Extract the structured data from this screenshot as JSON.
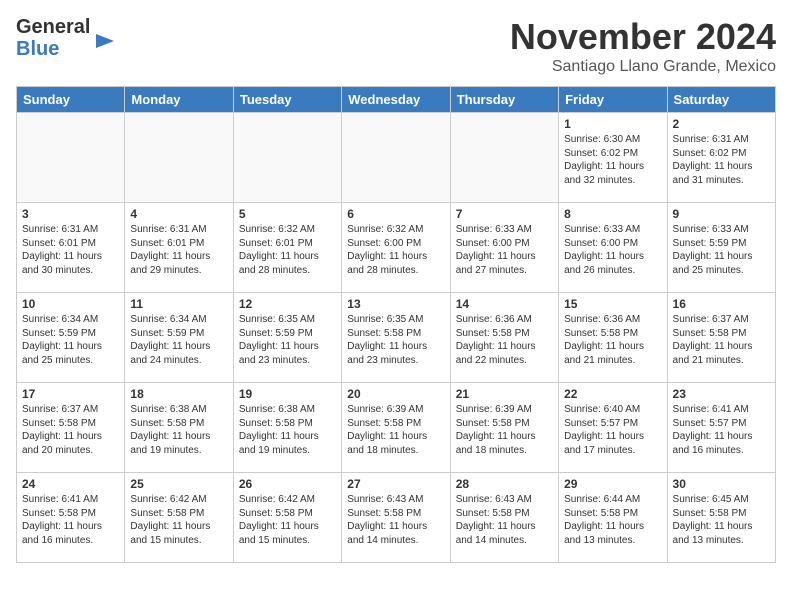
{
  "header": {
    "logo_line1": "General",
    "logo_line2": "Blue",
    "month": "November 2024",
    "location": "Santiago Llano Grande, Mexico"
  },
  "weekdays": [
    "Sunday",
    "Monday",
    "Tuesday",
    "Wednesday",
    "Thursday",
    "Friday",
    "Saturday"
  ],
  "weeks": [
    [
      {
        "day": "",
        "info": ""
      },
      {
        "day": "",
        "info": ""
      },
      {
        "day": "",
        "info": ""
      },
      {
        "day": "",
        "info": ""
      },
      {
        "day": "",
        "info": ""
      },
      {
        "day": "1",
        "info": "Sunrise: 6:30 AM\nSunset: 6:02 PM\nDaylight: 11 hours\nand 32 minutes."
      },
      {
        "day": "2",
        "info": "Sunrise: 6:31 AM\nSunset: 6:02 PM\nDaylight: 11 hours\nand 31 minutes."
      }
    ],
    [
      {
        "day": "3",
        "info": "Sunrise: 6:31 AM\nSunset: 6:01 PM\nDaylight: 11 hours\nand 30 minutes."
      },
      {
        "day": "4",
        "info": "Sunrise: 6:31 AM\nSunset: 6:01 PM\nDaylight: 11 hours\nand 29 minutes."
      },
      {
        "day": "5",
        "info": "Sunrise: 6:32 AM\nSunset: 6:01 PM\nDaylight: 11 hours\nand 28 minutes."
      },
      {
        "day": "6",
        "info": "Sunrise: 6:32 AM\nSunset: 6:00 PM\nDaylight: 11 hours\nand 28 minutes."
      },
      {
        "day": "7",
        "info": "Sunrise: 6:33 AM\nSunset: 6:00 PM\nDaylight: 11 hours\nand 27 minutes."
      },
      {
        "day": "8",
        "info": "Sunrise: 6:33 AM\nSunset: 6:00 PM\nDaylight: 11 hours\nand 26 minutes."
      },
      {
        "day": "9",
        "info": "Sunrise: 6:33 AM\nSunset: 5:59 PM\nDaylight: 11 hours\nand 25 minutes."
      }
    ],
    [
      {
        "day": "10",
        "info": "Sunrise: 6:34 AM\nSunset: 5:59 PM\nDaylight: 11 hours\nand 25 minutes."
      },
      {
        "day": "11",
        "info": "Sunrise: 6:34 AM\nSunset: 5:59 PM\nDaylight: 11 hours\nand 24 minutes."
      },
      {
        "day": "12",
        "info": "Sunrise: 6:35 AM\nSunset: 5:59 PM\nDaylight: 11 hours\nand 23 minutes."
      },
      {
        "day": "13",
        "info": "Sunrise: 6:35 AM\nSunset: 5:58 PM\nDaylight: 11 hours\nand 23 minutes."
      },
      {
        "day": "14",
        "info": "Sunrise: 6:36 AM\nSunset: 5:58 PM\nDaylight: 11 hours\nand 22 minutes."
      },
      {
        "day": "15",
        "info": "Sunrise: 6:36 AM\nSunset: 5:58 PM\nDaylight: 11 hours\nand 21 minutes."
      },
      {
        "day": "16",
        "info": "Sunrise: 6:37 AM\nSunset: 5:58 PM\nDaylight: 11 hours\nand 21 minutes."
      }
    ],
    [
      {
        "day": "17",
        "info": "Sunrise: 6:37 AM\nSunset: 5:58 PM\nDaylight: 11 hours\nand 20 minutes."
      },
      {
        "day": "18",
        "info": "Sunrise: 6:38 AM\nSunset: 5:58 PM\nDaylight: 11 hours\nand 19 minutes."
      },
      {
        "day": "19",
        "info": "Sunrise: 6:38 AM\nSunset: 5:58 PM\nDaylight: 11 hours\nand 19 minutes."
      },
      {
        "day": "20",
        "info": "Sunrise: 6:39 AM\nSunset: 5:58 PM\nDaylight: 11 hours\nand 18 minutes."
      },
      {
        "day": "21",
        "info": "Sunrise: 6:39 AM\nSunset: 5:58 PM\nDaylight: 11 hours\nand 18 minutes."
      },
      {
        "day": "22",
        "info": "Sunrise: 6:40 AM\nSunset: 5:57 PM\nDaylight: 11 hours\nand 17 minutes."
      },
      {
        "day": "23",
        "info": "Sunrise: 6:41 AM\nSunset: 5:57 PM\nDaylight: 11 hours\nand 16 minutes."
      }
    ],
    [
      {
        "day": "24",
        "info": "Sunrise: 6:41 AM\nSunset: 5:58 PM\nDaylight: 11 hours\nand 16 minutes."
      },
      {
        "day": "25",
        "info": "Sunrise: 6:42 AM\nSunset: 5:58 PM\nDaylight: 11 hours\nand 15 minutes."
      },
      {
        "day": "26",
        "info": "Sunrise: 6:42 AM\nSunset: 5:58 PM\nDaylight: 11 hours\nand 15 minutes."
      },
      {
        "day": "27",
        "info": "Sunrise: 6:43 AM\nSunset: 5:58 PM\nDaylight: 11 hours\nand 14 minutes."
      },
      {
        "day": "28",
        "info": "Sunrise: 6:43 AM\nSunset: 5:58 PM\nDaylight: 11 hours\nand 14 minutes."
      },
      {
        "day": "29",
        "info": "Sunrise: 6:44 AM\nSunset: 5:58 PM\nDaylight: 11 hours\nand 13 minutes."
      },
      {
        "day": "30",
        "info": "Sunrise: 6:45 AM\nSunset: 5:58 PM\nDaylight: 11 hours\nand 13 minutes."
      }
    ]
  ]
}
